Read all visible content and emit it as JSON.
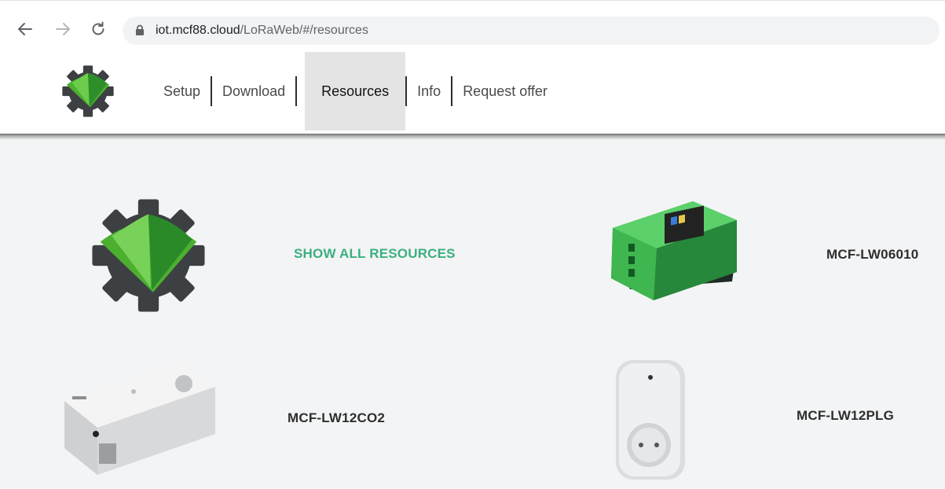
{
  "browser": {
    "url_host": "iot.mcf88.cloud",
    "url_path": "/LoRaWeb/#/resources",
    "icons": [
      "back-arrow-icon",
      "forward-arrow-icon",
      "reload-icon",
      "lock-icon"
    ]
  },
  "nav": {
    "items": [
      {
        "label": "Setup",
        "active": false
      },
      {
        "label": "Download",
        "active": false
      },
      {
        "label": "Resources",
        "active": true
      },
      {
        "label": "Info",
        "active": false
      },
      {
        "label": "Request offer",
        "active": false
      }
    ]
  },
  "resources": {
    "show_all_label": "SHOW ALL RESOURCES",
    "products": [
      {
        "label": "MCF-LW06010"
      },
      {
        "label": "MCF-LW12CO2"
      },
      {
        "label": "MCF-LW12PLG"
      }
    ]
  },
  "colors": {
    "accent_green": "#3bb07f",
    "logo_dark": "#3c4042",
    "logo_green": "#4caf2f",
    "active_tab_bg": "#e4e4e4"
  }
}
